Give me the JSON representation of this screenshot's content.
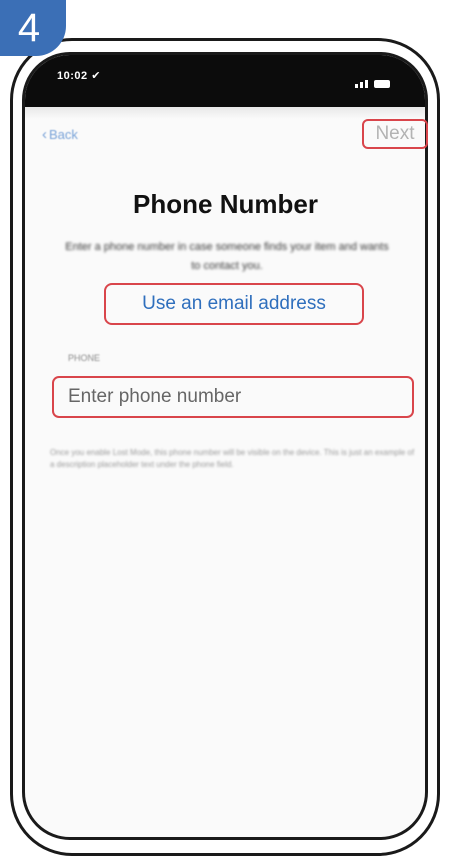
{
  "step": {
    "number": "4"
  },
  "status_bar": {
    "time": "10:02 ✔"
  },
  "nav": {
    "back_label": "Back",
    "next_label": "Next"
  },
  "main": {
    "title": "Phone Number",
    "description": "Enter a phone number in case someone finds your item and wants to contact you.",
    "email_link": "Use an email address",
    "field_label": "PHONE",
    "phone_placeholder": "Enter phone number",
    "note": "Once you enable Lost Mode, this phone number will be visible on the device. This is just an example of a description placeholder text under the phone field."
  },
  "colors": {
    "accent_blue": "#2f6fbd",
    "highlight_red": "#d9454b",
    "badge_blue": "#3b6fb6"
  }
}
